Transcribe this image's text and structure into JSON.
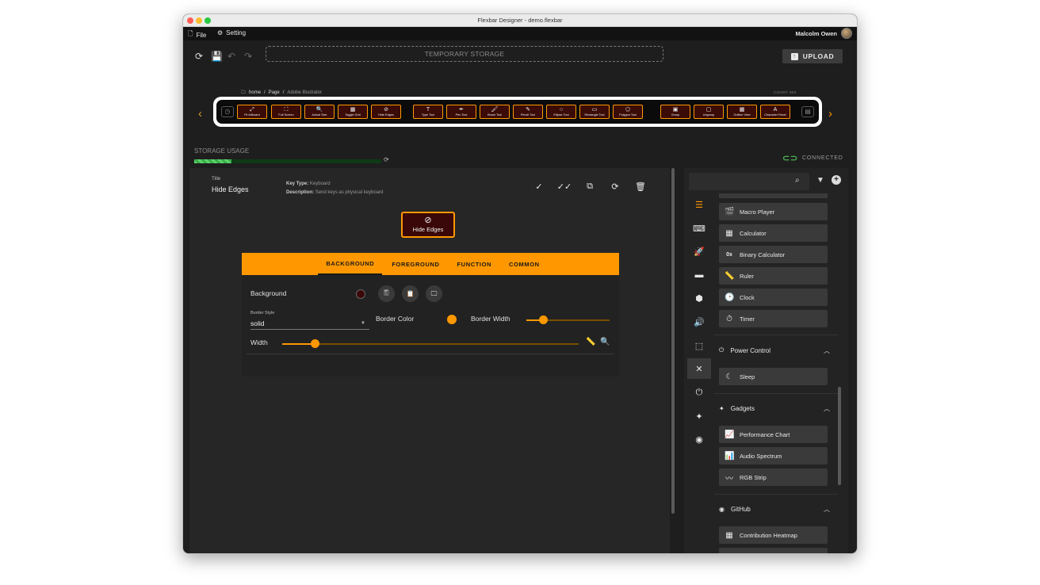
{
  "window": {
    "title": "Flexbar Designer - demo.flexbar"
  },
  "menu": {
    "file": "File",
    "setting": "Setting",
    "user": "Malcolm Owen"
  },
  "toolbar": {
    "temp_storage": "TEMPORARY STORAGE",
    "upload": "UPLOAD"
  },
  "breadcrumb": [
    "home",
    "/",
    "Page",
    "/",
    "Adobe Illustrator"
  ],
  "count_label": "COUNT: 850",
  "strip_keys": [
    {
      "icon": "⤢",
      "label": "Fit Artboard"
    },
    {
      "icon": "⛶",
      "label": "Full Screen"
    },
    {
      "icon": "🔍",
      "label": "Actual Size"
    },
    {
      "icon": "▦",
      "label": "Toggle Grid"
    },
    {
      "icon": "⊘",
      "label": "Hide Edges"
    },
    {
      "icon": "T",
      "label": "Type Tool"
    },
    {
      "icon": "✒",
      "label": "Pen Tool"
    },
    {
      "icon": "🖌",
      "label": "Brush Tool"
    },
    {
      "icon": "✎",
      "label": "Pencil Tool"
    },
    {
      "icon": "○",
      "label": "Ellipse Tool"
    },
    {
      "icon": "▭",
      "label": "Rectangle Tool"
    },
    {
      "icon": "⬠",
      "label": "Polygon Tool"
    },
    {
      "icon": "▣",
      "label": "Group"
    },
    {
      "icon": "▢",
      "label": "Ungroup"
    },
    {
      "icon": "▦",
      "label": "Outline View"
    },
    {
      "icon": "A",
      "label": "Character Panel"
    }
  ],
  "storage": {
    "label": "STORAGE USAGE",
    "fraction": 0.2
  },
  "connection": {
    "status": "CONNECTED",
    "color": "#4caf50"
  },
  "editor": {
    "title_label": "Title",
    "title": "Hide Edges",
    "key_type_label": "Key Type:",
    "key_type": "Keyboard",
    "description_label": "Description:",
    "description": "Send keys as physical keyboard",
    "preview_label": "Hide Edges",
    "tabs": [
      "BACKGROUND",
      "FOREGROUND",
      "FUNCTION",
      "COMMON"
    ],
    "active_tab": "BACKGROUND",
    "background_label": "Background",
    "background_color": "#3a0808",
    "border_style_label": "Border Style",
    "border_style": "solid",
    "border_color_label": "Border Color",
    "border_color": "#ff9800",
    "border_width_label": "Border Width",
    "border_width_fraction": 0.2,
    "width_label": "Width",
    "width_fraction": 0.11
  },
  "right_panel": {
    "widgets_top": [
      {
        "icon": "🎬",
        "label": "Macro Player"
      },
      {
        "icon": "▦",
        "label": "Calculator"
      },
      {
        "icon": "0x",
        "label": "Binary Calculator"
      },
      {
        "icon": "📏",
        "label": "Ruler"
      },
      {
        "icon": "🕒",
        "label": "Clock"
      },
      {
        "icon": "⏱",
        "label": "Timer"
      }
    ],
    "groups": [
      {
        "title": "Power Control",
        "icon": "⏻",
        "items": [
          {
            "icon": "☾",
            "label": "Sleep"
          }
        ]
      },
      {
        "title": "Gadgets",
        "icon": "✦",
        "items": [
          {
            "icon": "📈",
            "label": "Performance Chart"
          },
          {
            "icon": "📊",
            "label": "Audio Spectrum"
          },
          {
            "icon": "〰",
            "label": "RGB Strip"
          }
        ]
      },
      {
        "title": "GitHub",
        "icon": "◉",
        "items": [
          {
            "icon": "▦",
            "label": "Contribution Heatmap"
          }
        ]
      }
    ]
  },
  "colors": {
    "accent": "#ff9800",
    "bg": "#1e1e1e",
    "panel": "#262626"
  }
}
